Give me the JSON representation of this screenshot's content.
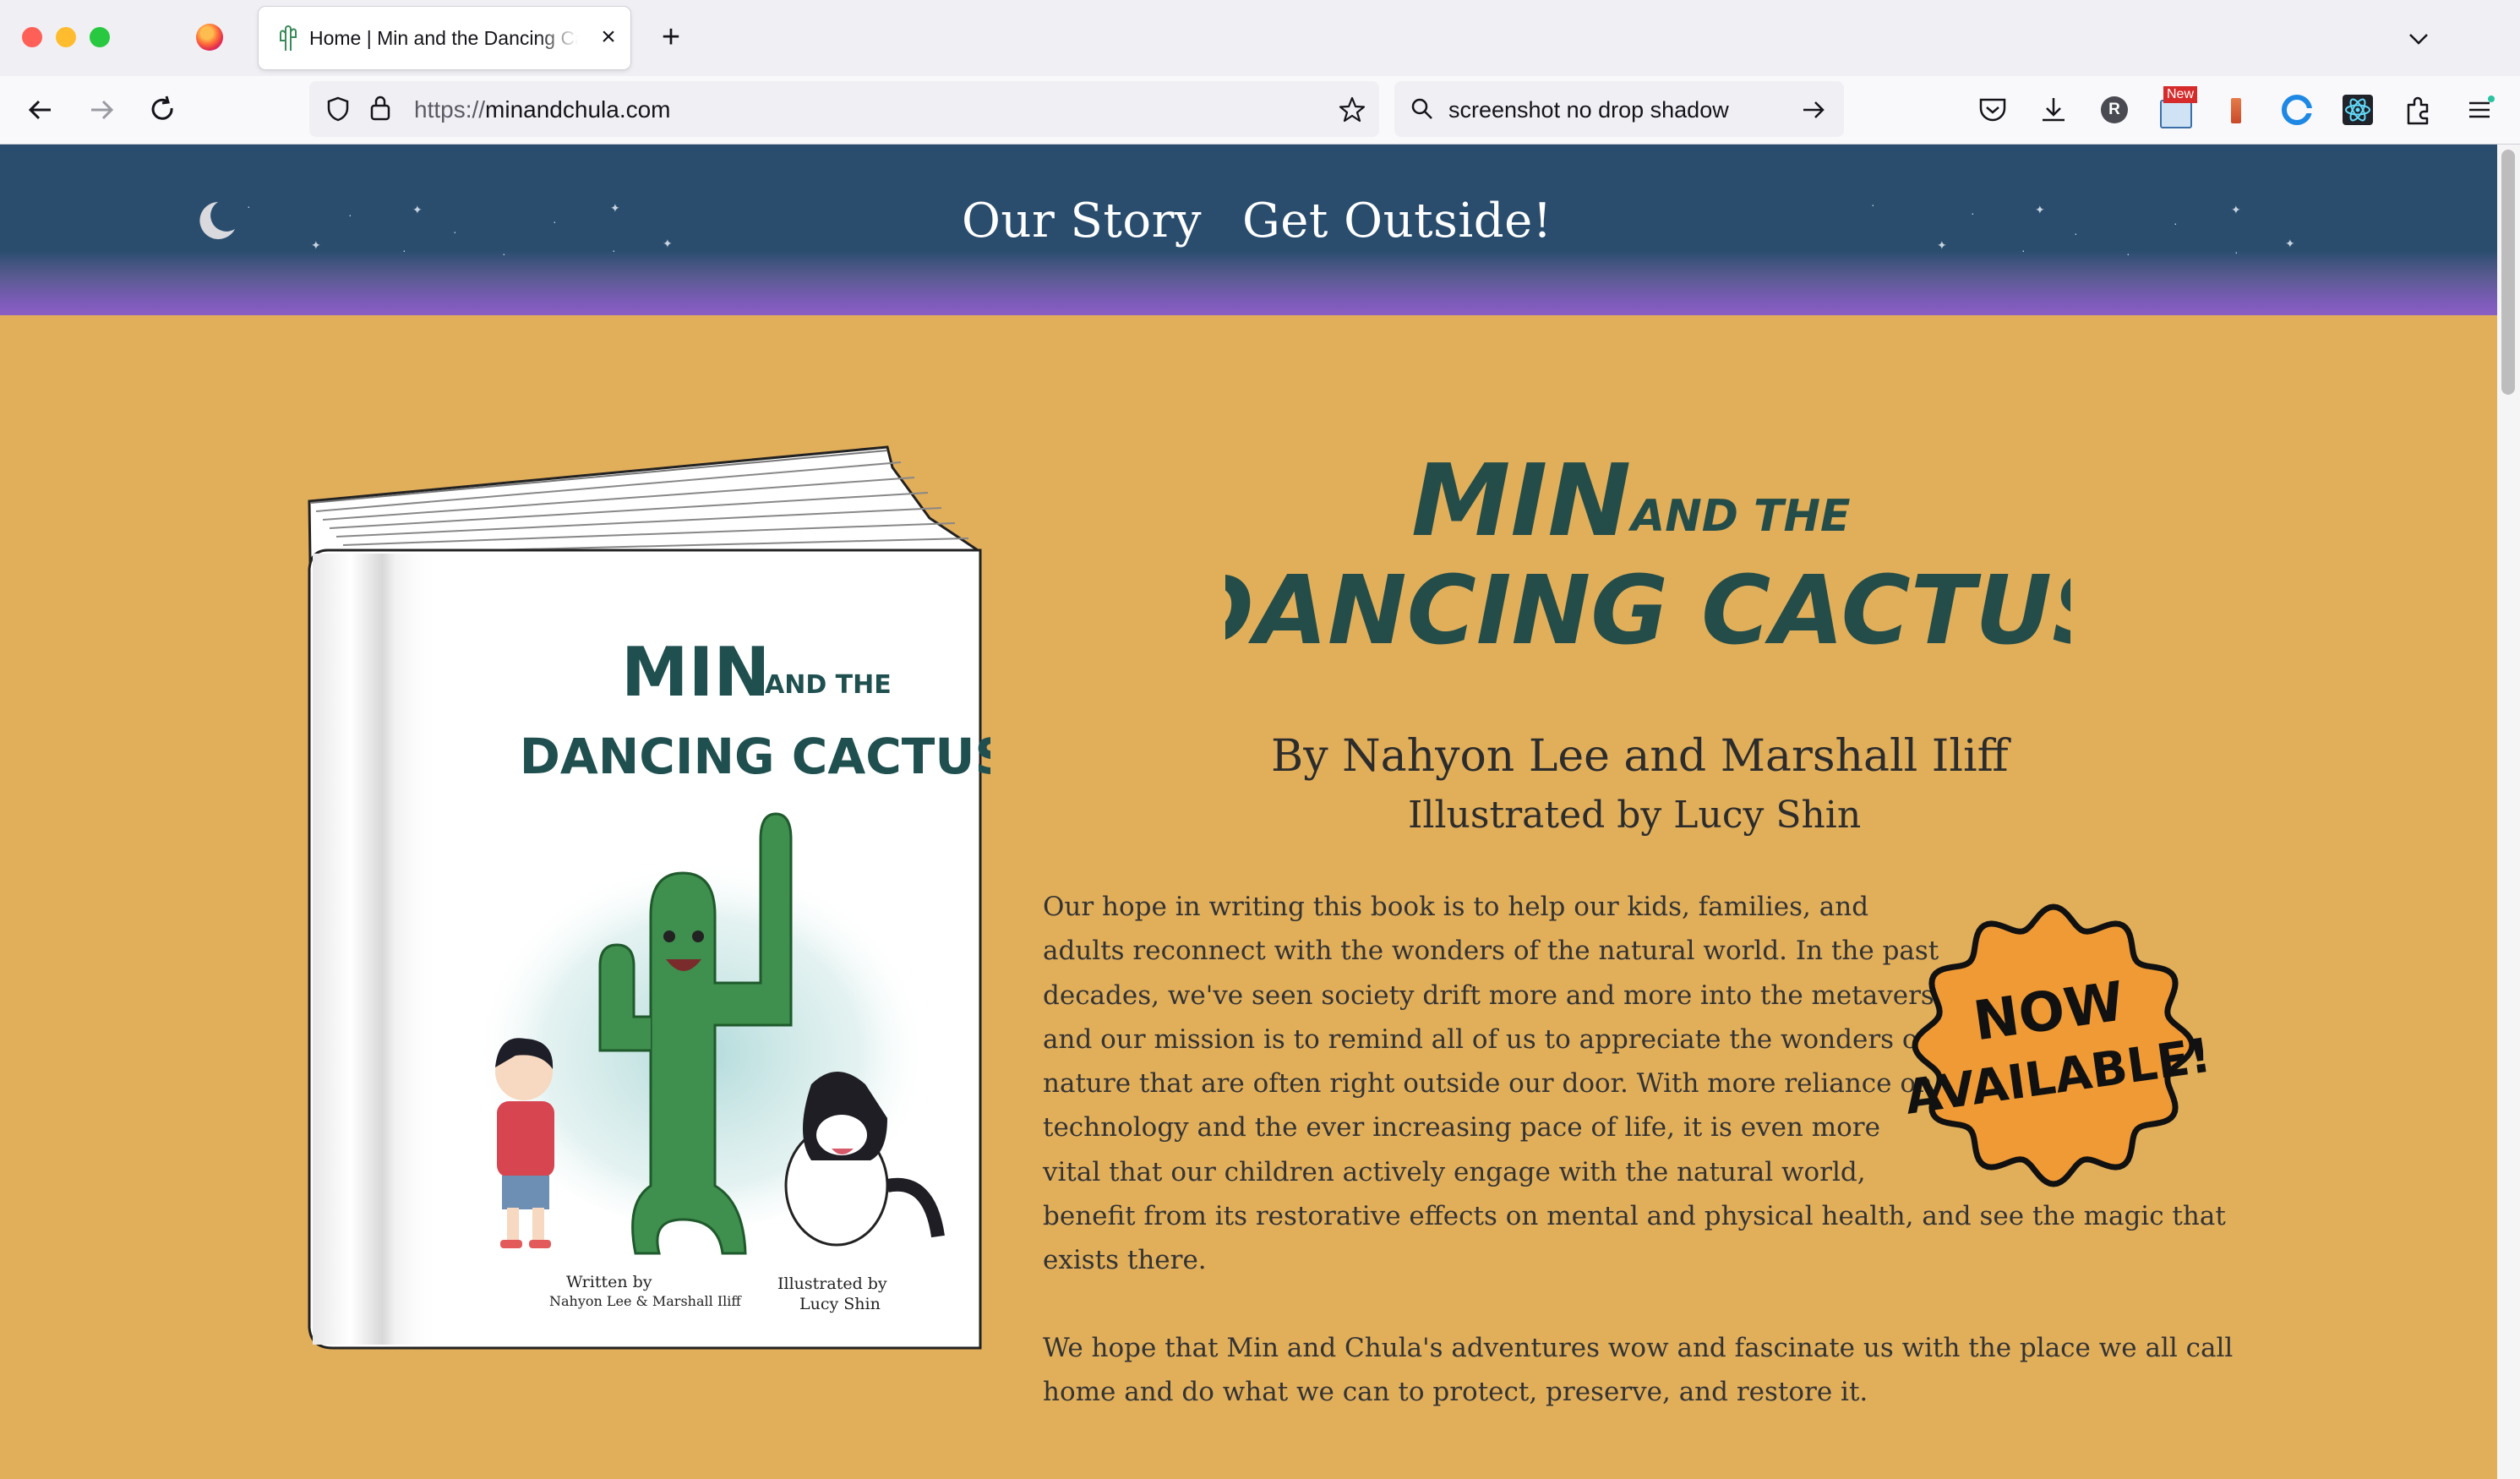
{
  "browser": {
    "tab_title": "Home | Min and the Dancing Cactus",
    "url_protocol": "https://",
    "url_domain": "minandchula.com",
    "search_text": "screenshot no drop shadow",
    "new_badge": "New",
    "profile_initial": "R"
  },
  "nav": {
    "links": [
      "Our Story",
      "Get Outside!"
    ]
  },
  "hero": {
    "title_line1_big": "MIN",
    "title_line1_small": "AND THE",
    "title_line2": "DANCING CACTUS",
    "byline": "By Nahyon Lee and Marshall Iliff",
    "illustrator": "Illustrated by Lucy Shin",
    "paragraph1_lines": [
      "Our hope in writing this book is to help our kids, families, and",
      "adults reconnect with the wonders of the natural world. In the past",
      "decades, we've seen society drift more and more into the metaverse",
      "and our mission is to remind all of us to appreciate the wonders of",
      "nature that are often right outside our door. With more reliance on",
      "technology and the ever increasing pace of life, it is even more",
      "vital that our children actively engage with the natural world,",
      "benefit from its restorative effects on mental and physical health, and see the magic that",
      "exists there."
    ],
    "paragraph2_lines": [
      "We hope that Min and Chula's adventures wow and fascinate us with the place we all call",
      "home and do what we can to protect, preserve, and restore it."
    ],
    "badge_line1": "NOW",
    "badge_line2": "AVAILABLE!"
  },
  "book_cover": {
    "title_big": "MIN",
    "title_small": "AND THE",
    "title_line2": "DANCING CACTUS",
    "written_by_label": "Written by",
    "authors": "Nahyon Lee & Marshall Iliff",
    "illustrated_by_label": "Illustrated by",
    "illustrator": "Lucy Shin"
  },
  "colors": {
    "header_bg": "#2a4d6e",
    "header_glow": "#8a5fc4",
    "page_bg": "#e1ae5a",
    "title_teal": "#1f4f4f",
    "badge_orange": "#f09a35"
  }
}
